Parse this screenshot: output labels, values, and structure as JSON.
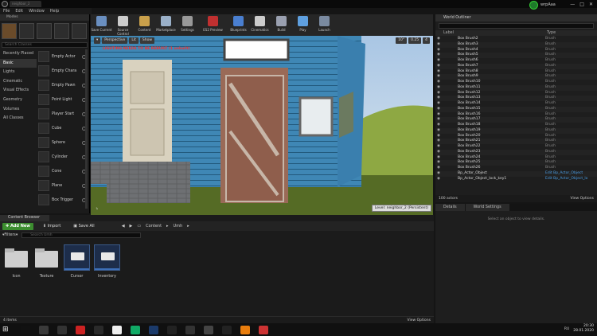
{
  "window": {
    "tab": "neighbor_2",
    "user": "wrpAaa"
  },
  "menu": [
    "File",
    "Edit",
    "Window",
    "Help"
  ],
  "modes": {
    "title": "Modes",
    "search_placeholder": "Search Classes",
    "categories": [
      "Recently Placed",
      "Basic",
      "Lights",
      "Cinematic",
      "Visual Effects",
      "Geometry",
      "Volumes",
      "All Classes"
    ],
    "selected_category": "Basic",
    "items": [
      "Empty Actor",
      "Empty Chara",
      "Empty Pawn",
      "Point Light",
      "Player Start",
      "Cube",
      "Sphere",
      "Cylinder",
      "Cone",
      "Plane",
      "Box Trigger"
    ]
  },
  "toolbar": [
    {
      "label": "Save Current",
      "color": "#6a8fc0"
    },
    {
      "label": "Source Control",
      "color": "#cccccc"
    },
    {
      "label": "Content",
      "color": "#c9a04b"
    },
    {
      "label": "Marketplace",
      "color": "#9ab0c8"
    },
    {
      "label": "Settings",
      "color": "#999999"
    },
    {
      "label": "ES2 Preview",
      "color": "#c03030"
    },
    {
      "label": "Blueprints",
      "color": "#4a7fd0"
    },
    {
      "label": "Cinematics",
      "color": "#cccccc"
    },
    {
      "label": "Build",
      "color": "#9aa0b0"
    },
    {
      "label": "Play",
      "color": "#5fa0e0"
    },
    {
      "label": "Launch",
      "color": "#7a8aa0"
    }
  ],
  "viewport": {
    "buttons": [
      "Perspective",
      "Lit",
      "Show"
    ],
    "warning": "LIGHTING NEEDS TO BE REBUILT (1 unbuilt)",
    "snap": [
      "10°",
      "0.25",
      "4"
    ],
    "level": "Level:  neighbor_2 (Persistent)"
  },
  "outliner": {
    "title": "World Outliner",
    "columns": [
      "Label",
      "Type"
    ],
    "rows": [
      {
        "label": "Box Brush2",
        "type": "Brush"
      },
      {
        "label": "Box Brush3",
        "type": "Brush"
      },
      {
        "label": "Box Brush4",
        "type": "Brush"
      },
      {
        "label": "Box Brush5",
        "type": "Brush"
      },
      {
        "label": "Box Brush6",
        "type": "Brush"
      },
      {
        "label": "Box Brush7",
        "type": "Brush"
      },
      {
        "label": "Box Brush8",
        "type": "Brush"
      },
      {
        "label": "Box Brush9",
        "type": "Brush"
      },
      {
        "label": "Box Brush10",
        "type": "Brush"
      },
      {
        "label": "Box Brush11",
        "type": "Brush"
      },
      {
        "label": "Box Brush12",
        "type": "Brush"
      },
      {
        "label": "Box Brush13",
        "type": "Brush"
      },
      {
        "label": "Box Brush14",
        "type": "Brush"
      },
      {
        "label": "Box Brush15",
        "type": "Brush"
      },
      {
        "label": "Box Brush16",
        "type": "Brush"
      },
      {
        "label": "Box Brush17",
        "type": "Brush"
      },
      {
        "label": "Box Brush18",
        "type": "Brush"
      },
      {
        "label": "Box Brush19",
        "type": "Brush"
      },
      {
        "label": "Box Brush20",
        "type": "Brush"
      },
      {
        "label": "Box Brush21",
        "type": "Brush"
      },
      {
        "label": "Box Brush22",
        "type": "Brush"
      },
      {
        "label": "Box Brush23",
        "type": "Brush"
      },
      {
        "label": "Box Brush24",
        "type": "Brush"
      },
      {
        "label": "Box Brush25",
        "type": "Brush"
      },
      {
        "label": "Box Brush26",
        "type": "Brush"
      },
      {
        "label": "Bp_Actor_Object",
        "type": "Edit Bp_Actor_Object"
      },
      {
        "label": "Bp_Actor_Object_lock_key1",
        "type": "Edit Bp_Actor_Object_lo"
      }
    ],
    "count": "100 actors",
    "view_options": "View Options"
  },
  "details": {
    "tabs": [
      "Details",
      "World Settings"
    ],
    "message": "Select an object to view details."
  },
  "content_browser": {
    "title": "Content Browser",
    "add_new": "Add New",
    "import": "Import",
    "save_all": "Save All",
    "path": [
      "Content",
      "Umh"
    ],
    "filters": "Filters",
    "search_placeholder": "Search Umh",
    "assets": [
      {
        "name": "Icon",
        "kind": "folder"
      },
      {
        "name": "Texture",
        "kind": "folder"
      },
      {
        "name": "Cursor",
        "kind": "widget"
      },
      {
        "name": "Inventory",
        "kind": "widget"
      }
    ],
    "count": "4 items",
    "view_options": "View Options"
  },
  "taskbar": {
    "icons": [
      "windows-icon",
      "search-icon",
      "steam-icon",
      "epic-icon",
      "app-icon",
      "app-icon",
      "app-icon",
      "app-icon",
      "photoshop-icon",
      "epic-games-icon",
      "app-icon",
      "unreal-icon",
      "app-icon",
      "blender-icon",
      "chrome-icon"
    ],
    "lang": "RU",
    "time": "20:30",
    "date": "28.01.2020"
  }
}
